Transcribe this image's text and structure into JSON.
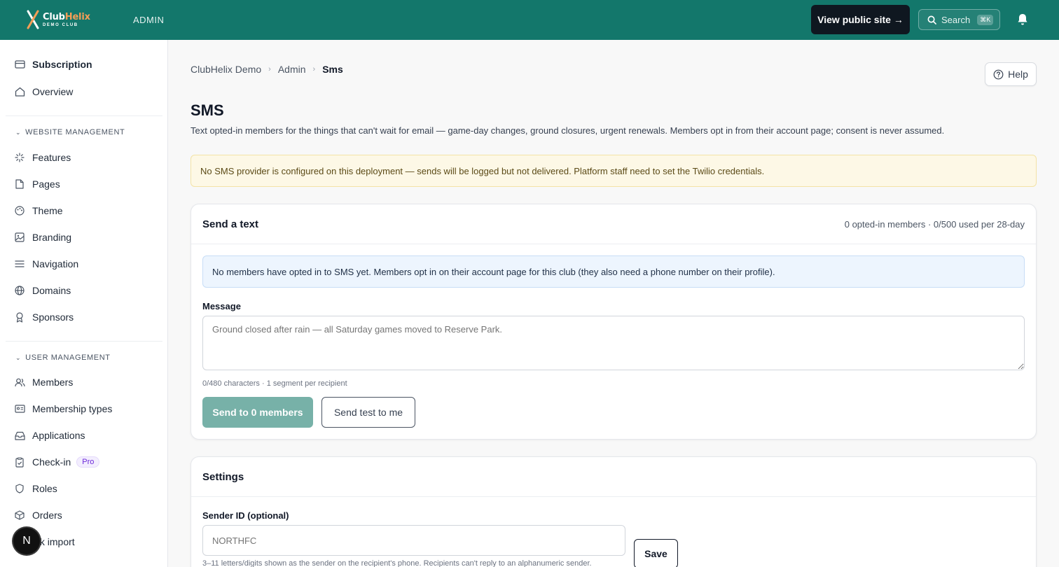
{
  "header": {
    "logo_name_part1": "Club",
    "logo_name_part2": "Helix",
    "logo_sub": "DEMO CLUB",
    "admin_label": "ADMIN",
    "view_public_label": "View public site →",
    "search_label": "Search",
    "search_shortcut": "⌘K"
  },
  "sidebar": {
    "top_items": [
      {
        "label": "Subscription",
        "icon": "credit-card-icon"
      },
      {
        "label": "Overview",
        "icon": "home-icon"
      }
    ],
    "website_section": "WEBSITE MANAGEMENT",
    "website_items": [
      {
        "label": "Features",
        "icon": "sparkle-icon"
      },
      {
        "label": "Pages",
        "icon": "file-icon"
      },
      {
        "label": "Theme",
        "icon": "palette-icon"
      },
      {
        "label": "Branding",
        "icon": "image-icon"
      },
      {
        "label": "Navigation",
        "icon": "menu-icon"
      },
      {
        "label": "Domains",
        "icon": "globe-icon"
      },
      {
        "label": "Sponsors",
        "icon": "award-icon"
      }
    ],
    "user_section": "USER MANAGEMENT",
    "user_items": [
      {
        "label": "Members",
        "icon": "users-icon"
      },
      {
        "label": "Membership types",
        "icon": "id-card-icon"
      },
      {
        "label": "Applications",
        "icon": "inbox-icon"
      },
      {
        "label": "Check-in",
        "icon": "clipboard-check-icon",
        "badge": "Pro"
      },
      {
        "label": "Roles",
        "icon": "shield-icon"
      },
      {
        "label": "Orders",
        "icon": "package-icon"
      },
      {
        "label": "ulk import",
        "icon": "upload-icon"
      }
    ],
    "fab_letter": "N"
  },
  "breadcrumb": [
    "ClubHelix Demo",
    "Admin",
    "Sms"
  ],
  "help_label": "Help",
  "page": {
    "title": "SMS",
    "description": "Text opted-in members for the things that can't wait for email — game-day changes, ground closures, urgent renewals. Members opt in from their account page; consent is never assumed.",
    "warning": "No SMS provider is configured on this deployment — sends will be logged but not delivered. Platform staff need to set the Twilio credentials."
  },
  "send_card": {
    "title": "Send a text",
    "meta": "0 opted-in members · 0/500 used per 28-day",
    "info": "No members have opted in to SMS yet. Members opt in on their account page for this club (they also need a phone number on their profile).",
    "message_label": "Message",
    "message_placeholder": "Ground closed after rain — all Saturday games moved to Reserve Park.",
    "char_hint": "0/480 characters · 1 segment per recipient",
    "send_label": "Send to 0 members",
    "test_label": "Send test to me"
  },
  "settings_card": {
    "title": "Settings",
    "sender_label": "Sender ID (optional)",
    "sender_placeholder": "NORTHFC",
    "save_label": "Save",
    "sender_hint": "3–11 letters/digits shown as the sender on the recipient's phone. Recipients can't reply to an alphanumeric sender."
  },
  "colors": {
    "topbar": "#13776b",
    "accent_orange": "#f59e56",
    "send_button": "#77b1a8",
    "warning_bg": "#fdf8e6",
    "info_bg": "#edf5fe"
  }
}
